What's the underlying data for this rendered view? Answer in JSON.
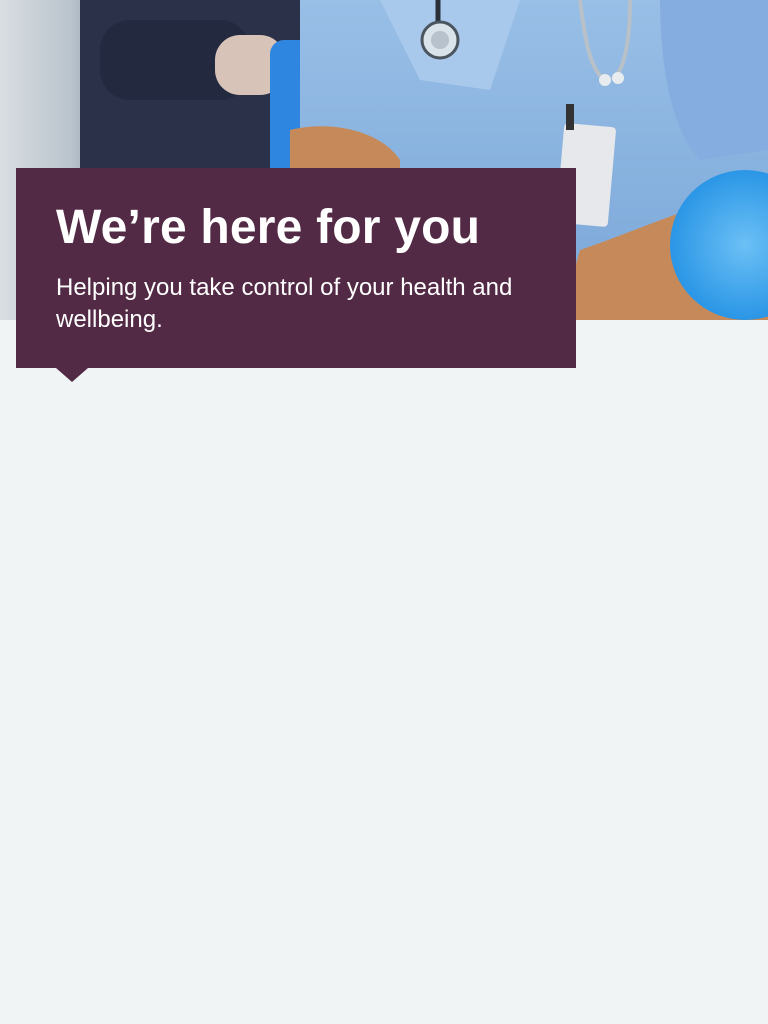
{
  "hero": {
    "image_description_icon": "nurse-photo-icon",
    "colors": {
      "scrubs": "#8fb8e0",
      "scrubs_shadow": "#6e9bcd",
      "skin": "#c68a5a",
      "dark_clothing": "#2a3148",
      "chair_blue": "#2f86e0"
    }
  },
  "promo": {
    "title": "We’re here for you",
    "subtitle": "Helping you take control of your health and wellbeing.",
    "background_color": "#532a45",
    "text_color": "#ffffff"
  },
  "page": {
    "background_color": "#f0f4f5"
  }
}
